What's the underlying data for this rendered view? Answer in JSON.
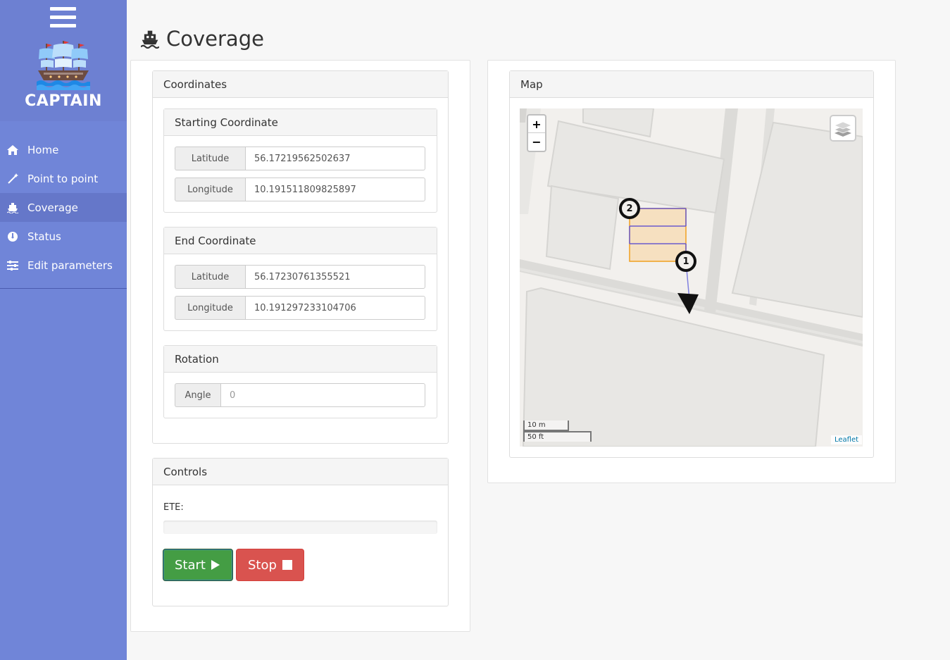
{
  "app": {
    "brand": "CAPTAIN",
    "page_title": "Coverage"
  },
  "sidebar": {
    "items": [
      {
        "label": "Home",
        "icon": "home-icon"
      },
      {
        "label": "Point to point",
        "icon": "wand-icon"
      },
      {
        "label": "Coverage",
        "icon": "ship-icon",
        "active": true
      },
      {
        "label": "Status",
        "icon": "gauge-icon"
      },
      {
        "label": "Edit parameters",
        "icon": "sliders-icon"
      }
    ]
  },
  "coordinates": {
    "heading": "Coordinates",
    "start": {
      "heading": "Starting Coordinate",
      "latitude_label": "Latitude",
      "latitude": "56.17219562502637",
      "longitude_label": "Longitude",
      "longitude": "10.191511809825897"
    },
    "end": {
      "heading": "End Coordinate",
      "latitude_label": "Latitude",
      "latitude": "56.17230761355521",
      "longitude_label": "Longitude",
      "longitude": "10.191297233104706"
    },
    "rotation": {
      "heading": "Rotation",
      "angle_label": "Angle",
      "angle_placeholder": "0"
    }
  },
  "controls": {
    "heading": "Controls",
    "ete_label": "ETE:",
    "progress": 0,
    "start_label": "Start",
    "stop_label": "Stop"
  },
  "map": {
    "heading": "Map",
    "zoom_in": "+",
    "zoom_out": "−",
    "scale_metric": "10 m",
    "scale_imperial": "50 ft",
    "attribution": "Leaflet",
    "marker_start": "1",
    "marker_end": "2"
  },
  "colors": {
    "sidebar": "#7085d8",
    "start_button": "#449d44",
    "stop_button": "#d9534f",
    "coverage_fill": "#f6e0c0",
    "coverage_border": "#f0a020",
    "path_line": "#6a5acd"
  }
}
